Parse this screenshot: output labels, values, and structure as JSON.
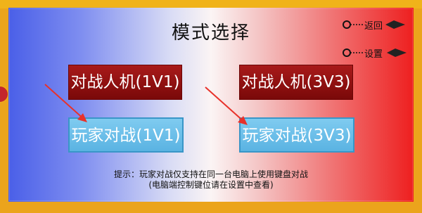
{
  "title": "模式选择",
  "nav": {
    "back_label": "返回",
    "settings_label": "设置"
  },
  "modes": {
    "pve_1v1": "对战人机(1V1)",
    "pve_3v3": "对战人机(3V3)",
    "pvp_1v1": "玩家对战(1V1)",
    "pvp_3v3": "玩家对战(3V3)"
  },
  "hint": {
    "line1": "提示：玩家对战仅支持在同一台电脑上使用键盘对战",
    "line2": "(电脑端控制键位请在设置中查看)"
  },
  "colors": {
    "frame": "#eba41c",
    "dark_button": "#8a1010",
    "light_button": "#6ec0ea",
    "arrow": "#e8312a"
  }
}
